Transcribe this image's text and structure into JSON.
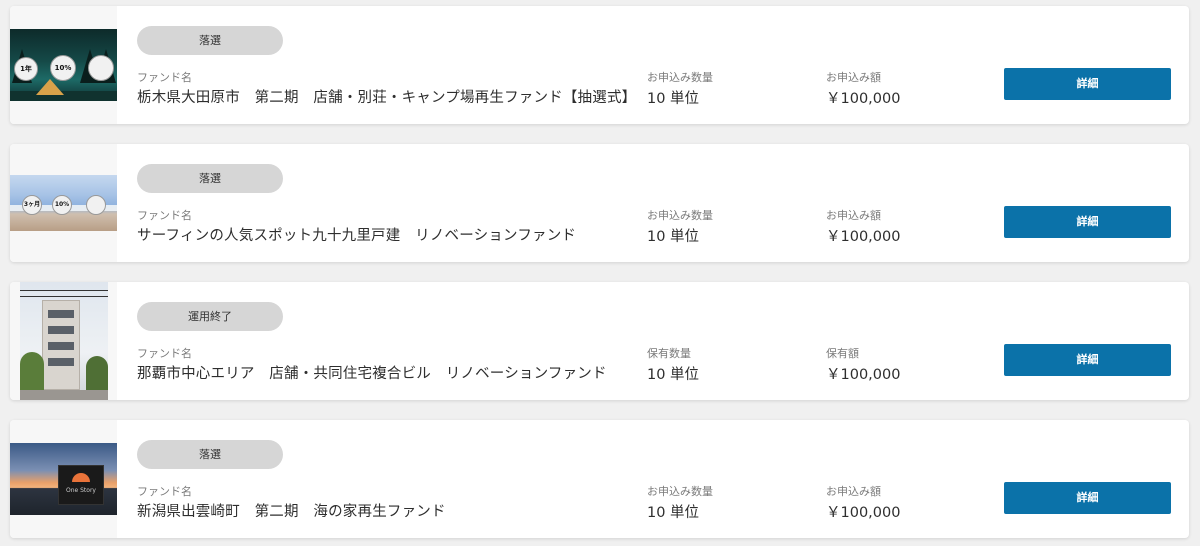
{
  "colors": {
    "accent": "#0b72a9",
    "pill_bg": "#d6d6d6",
    "page_bg": "#f0f0f0"
  },
  "funds": [
    {
      "status": "落選",
      "fund_label": "ファンド名",
      "fund_name": "栃木県大田原市　第二期　店舗・別荘・キャンプ場再生ファンド【抽選式】",
      "qty_label": "お申込み数量",
      "qty_value": "10 単位",
      "amount_label": "お申込み額",
      "amount_value": "￥100,000",
      "button": "詳細",
      "thumb_badges": [
        "1年",
        "10%"
      ]
    },
    {
      "status": "落選",
      "fund_label": "ファンド名",
      "fund_name": "サーフィンの人気スポット九十九里戸建　リノベーションファンド",
      "qty_label": "お申込み数量",
      "qty_value": "10 単位",
      "amount_label": "お申込み額",
      "amount_value": "￥100,000",
      "button": "詳細",
      "thumb_badges": [
        "3ヶ月",
        "10%"
      ]
    },
    {
      "status": "運用終了",
      "fund_label": "ファンド名",
      "fund_name": "那覇市中心エリア　店舗・共同住宅複合ビル　リノベーションファンド",
      "qty_label": "保有数量",
      "qty_value": "10 単位",
      "amount_label": "保有額",
      "amount_value": "￥100,000",
      "button": "詳細"
    },
    {
      "status": "落選",
      "fund_label": "ファンド名",
      "fund_name": "新潟県出雲崎町　第二期　海の家再生ファンド",
      "qty_label": "お申込み数量",
      "qty_value": "10 単位",
      "amount_label": "お申込み額",
      "amount_value": "￥100,000",
      "button": "詳細",
      "thumb_sign": "One Story"
    }
  ]
}
